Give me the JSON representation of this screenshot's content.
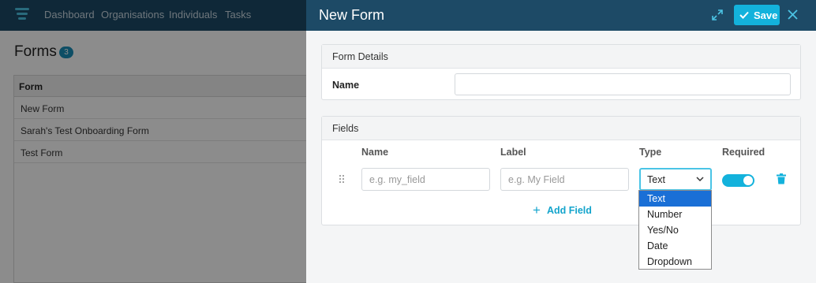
{
  "nav": {
    "links": [
      "Dashboard",
      "Organisations",
      "Individuals",
      "Tasks"
    ]
  },
  "forms_page": {
    "title": "Forms",
    "count": "3",
    "column_header": "Form",
    "rows": [
      "New Form",
      "Sarah's Test Onboarding Form",
      "Test Form"
    ]
  },
  "drawer": {
    "title": "New Form",
    "save_label": "Save",
    "expand_icon": "expand-icon",
    "close_icon": "close-icon"
  },
  "form_details": {
    "section_title": "Form Details",
    "name_label": "Name",
    "name_value": ""
  },
  "fields": {
    "section_title": "Fields",
    "columns": {
      "name": "Name",
      "label": "Label",
      "type": "Type",
      "required": "Required"
    },
    "row": {
      "name_placeholder": "e.g. my_field",
      "label_placeholder": "e.g. My Field",
      "type_value": "Text",
      "required": true
    },
    "add_label": "Add Field"
  },
  "type_options": [
    "Text",
    "Number",
    "Yes/No",
    "Date",
    "Dropdown"
  ],
  "type_selected": "Text",
  "colors": {
    "header": "#1d4a66",
    "accent": "#13b2dc",
    "selected_option": "#1a6fd6"
  }
}
